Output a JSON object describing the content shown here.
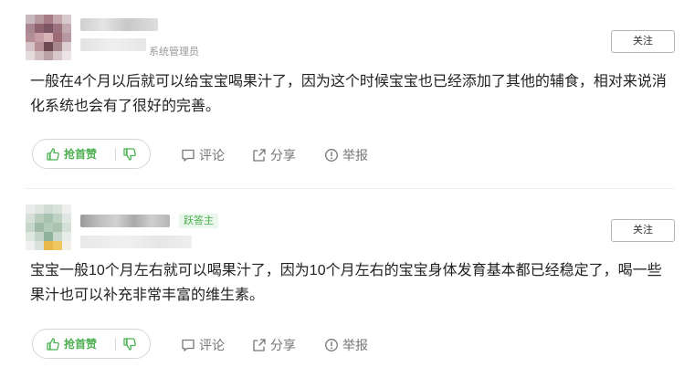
{
  "answers": [
    {
      "user_role": "系统管理员",
      "badge": "",
      "follow_label": "关注",
      "content": "一般在4个月以后就可以给宝宝喝果汁了，因为这个时候宝宝也已经添加了其他的辅食，相对来说消化系统也会有了很好的完善。",
      "vote_label": "抢首赞",
      "actions": {
        "comment": "评论",
        "share": "分享",
        "report": "举报"
      }
    },
    {
      "user_role": "",
      "badge": "跃答主",
      "follow_label": "关注",
      "content": "宝宝一般10个月左右就可以喝果汁了，因为10个月左右的宝宝身体发育基本都已经稳定了，喝一些果汁也可以补充非常丰富的维生素。",
      "vote_label": "抢首赞",
      "actions": {
        "comment": "评论",
        "share": "分享",
        "report": "举报"
      }
    }
  ],
  "colors": {
    "accent_green": "#4caf50",
    "muted_text": "#777777",
    "border": "#d6d6d6"
  },
  "icons": {
    "like": "thumbs-up-icon",
    "dislike": "thumbs-down-icon",
    "comment": "comment-icon",
    "share": "share-icon",
    "report": "report-icon"
  }
}
